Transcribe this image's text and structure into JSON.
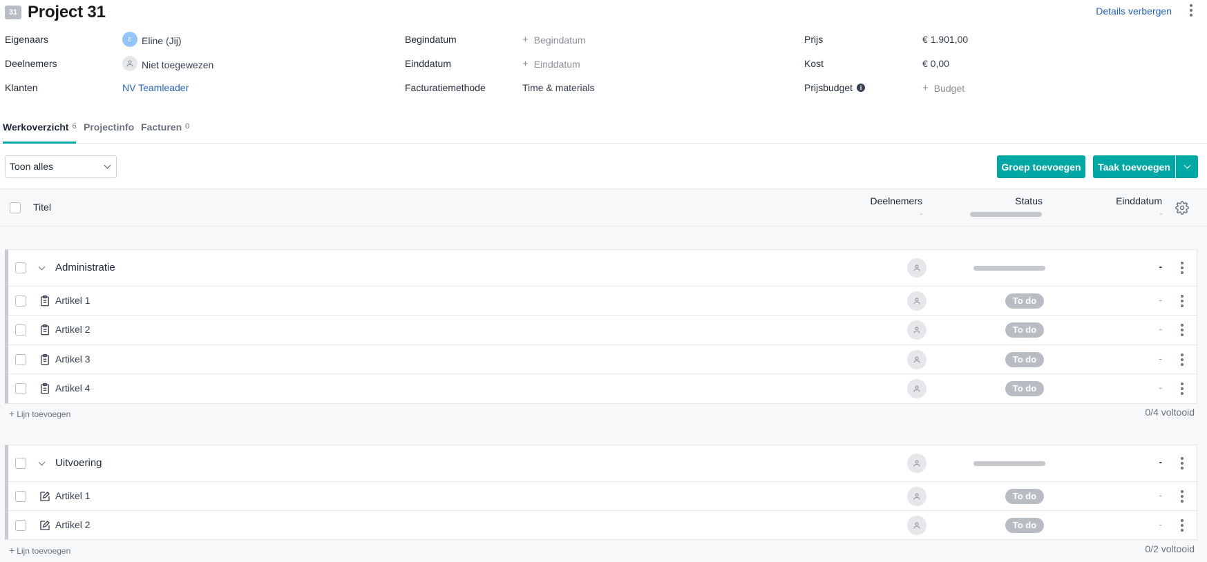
{
  "project": {
    "badge": "31",
    "title": "Project 31",
    "details_link": "Details verbergen"
  },
  "details": {
    "owners_label": "Eigenaars",
    "owner_initial": "E",
    "owner_name": "Eline (Jij)",
    "participants_label": "Deelnemers",
    "participants_value": "Niet toegewezen",
    "clients_label": "Klanten",
    "client_value": "NV Teamleader",
    "start_label": "Begindatum",
    "start_value": "Begindatum",
    "end_label": "Einddatum",
    "end_value": "Einddatum",
    "billing_label": "Facturatiemethode",
    "billing_value": "Time & materials",
    "price_label": "Prijs",
    "price_value": "€ 1.901,00",
    "cost_label": "Kost",
    "cost_value": "€ 0,00",
    "budget_label": "Prijsbudget",
    "budget_value": "Budget"
  },
  "tabs": [
    {
      "label": "Werkoverzicht",
      "count": "6"
    },
    {
      "label": "Projectinfo",
      "count": ""
    },
    {
      "label": "Facturen",
      "count": "0"
    }
  ],
  "toolbar": {
    "filter_value": "Toon alles",
    "add_group": "Groep toevoegen",
    "add_task": "Taak toevoegen"
  },
  "table_header": {
    "title": "Titel",
    "participants": "Deelnemers",
    "participants_sub": "-",
    "status": "Status",
    "due": "Einddatum",
    "due_sub": "-"
  },
  "groups": [
    {
      "name": "Administratie",
      "due": "-",
      "add_line": "Lijn toevoegen",
      "completed": "0/4 voltooid",
      "tasks": [
        {
          "name": "Artikel 1",
          "status": "To do",
          "due": "-"
        },
        {
          "name": "Artikel 2",
          "status": "To do",
          "due": "-"
        },
        {
          "name": "Artikel 3",
          "status": "To do",
          "due": "-"
        },
        {
          "name": "Artikel 4",
          "status": "To do",
          "due": "-"
        }
      ]
    },
    {
      "name": "Uitvoering",
      "due": "-",
      "add_line": "Lijn toevoegen",
      "completed": "0/2 voltooid",
      "tasks": [
        {
          "name": "Artikel 1",
          "status": "To do",
          "due": "-"
        },
        {
          "name": "Artikel 2",
          "status": "To do",
          "due": "-"
        }
      ]
    }
  ],
  "colors": {
    "accent": "#00a8a5",
    "link": "#2563c7",
    "pill": "#b8bcc3"
  },
  "icons": {
    "clipboard": "clipboard-icon",
    "edit": "edit-icon",
    "user": "user-icon",
    "gear": "gear-icon",
    "kebab": "more-vertical-icon"
  }
}
